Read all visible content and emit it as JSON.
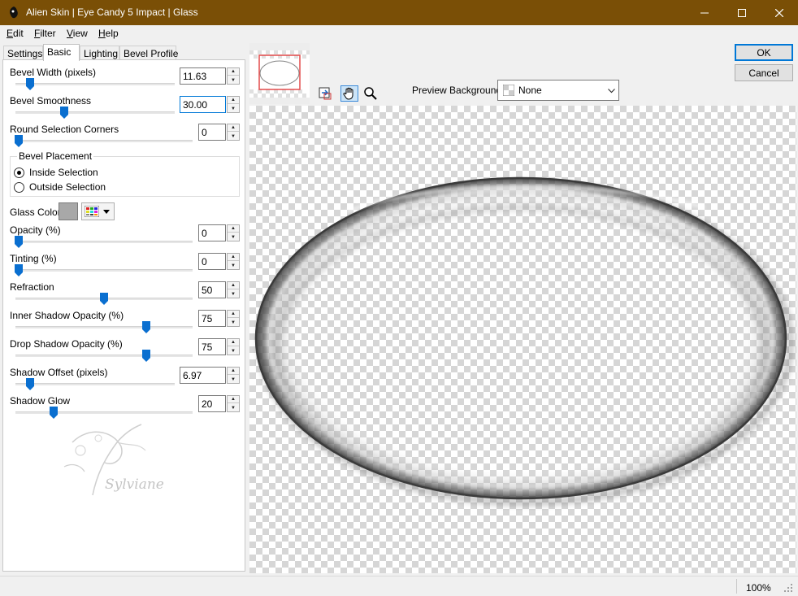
{
  "window": {
    "title": "Alien Skin | Eye Candy 5 Impact | Glass"
  },
  "menu": [
    {
      "label": "Edit",
      "accel": "E",
      "rest": "dit"
    },
    {
      "label": "Filter",
      "accel": "F",
      "rest": "ilter"
    },
    {
      "label": "View",
      "accel": "V",
      "rest": "iew"
    },
    {
      "label": "Help",
      "accel": "H",
      "rest": "elp"
    }
  ],
  "tabs": [
    "Settings",
    "Basic",
    "Lighting",
    "Bevel Profile"
  ],
  "active_tab": "Basic",
  "controls": {
    "bevel_width": {
      "label": "Bevel Width (pixels)",
      "value": "11.63"
    },
    "bevel_smoothness": {
      "label": "Bevel Smoothness",
      "value": "30.00"
    },
    "round_corners": {
      "label": "Round Selection Corners",
      "value": "0"
    },
    "bevel_placement": {
      "label": "Bevel Placement",
      "inside": "Inside Selection",
      "outside": "Outside Selection",
      "selected": "Inside Selection"
    },
    "glass_color": {
      "label": "Glass Color",
      "swatch": "#a8a8a8"
    },
    "opacity": {
      "label": "Opacity (%)",
      "value": "0"
    },
    "tinting": {
      "label": "Tinting (%)",
      "value": "0"
    },
    "refraction": {
      "label": "Refraction",
      "value": "50"
    },
    "inner_shadow": {
      "label": "Inner Shadow Opacity (%)",
      "value": "75"
    },
    "drop_shadow": {
      "label": "Drop Shadow Opacity (%)",
      "value": "75"
    },
    "shadow_offset": {
      "label": "Shadow Offset (pixels)",
      "value": "6.97"
    },
    "shadow_glow": {
      "label": "Shadow Glow",
      "value": "20"
    }
  },
  "buttons": {
    "ok": "OK",
    "cancel": "Cancel"
  },
  "preview": {
    "background_label": "Preview Background:",
    "background_value": "None"
  },
  "watermark": "Sylviane",
  "status": {
    "zoom": "100%"
  },
  "colors": {
    "titlebar": "#7a4f06",
    "accent": "#0078d7",
    "thumb_blue": "#0a6fd0"
  },
  "icons": [
    "app-icon",
    "minimize-icon",
    "maximize-icon",
    "close-icon",
    "navigator-icon",
    "hand-icon",
    "zoom-icon",
    "color-palette-icon",
    "dropdown-arrow-icon"
  ]
}
